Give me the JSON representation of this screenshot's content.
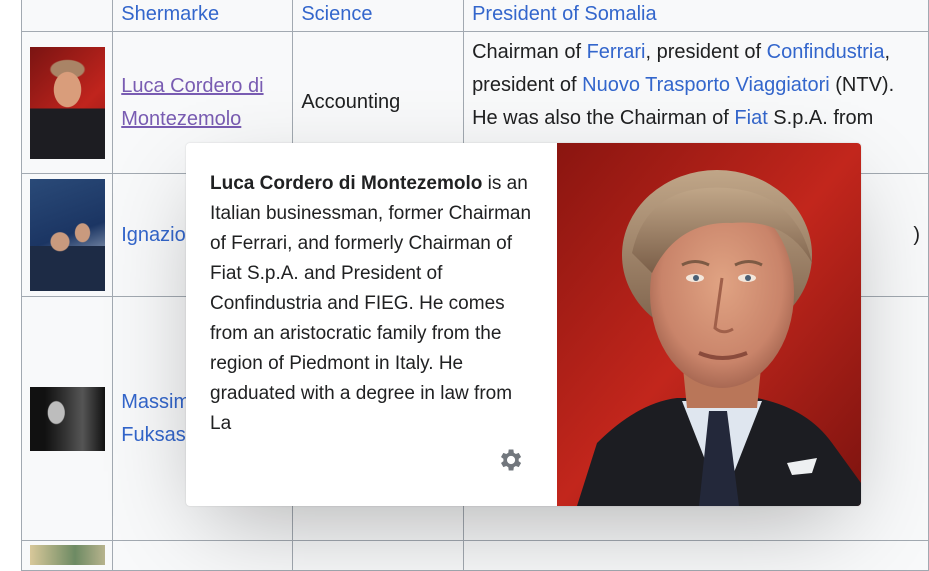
{
  "table": {
    "rows": [
      {
        "name": "Shermarke",
        "field": "Science",
        "note_parts": [
          {
            "text": "President of Somalia",
            "link": true
          }
        ]
      },
      {
        "thumb": "photo-montezemolo",
        "name": "Luca Cordero di Montezemolo",
        "visited": true,
        "field": "Accounting",
        "note_parts": [
          {
            "text": "Chairman of ",
            "link": false
          },
          {
            "text": "Ferrari",
            "link": true
          },
          {
            "text": ", president of ",
            "link": false
          },
          {
            "text": "Confindustria",
            "link": true
          },
          {
            "text": ", president of ",
            "link": false
          },
          {
            "text": "Nuovo Trasporto Viaggiatori",
            "link": true
          },
          {
            "text": " (NTV). He was also the Chairman of ",
            "link": false
          },
          {
            "text": "Fiat",
            "link": true
          },
          {
            "text": " S.p.A. from",
            "link": false
          }
        ]
      },
      {
        "thumb": "photo-ignazio",
        "name": "Ignazio",
        "field": "",
        "note_parts": [
          {
            "text": ")",
            "link": false
          }
        ]
      },
      {
        "thumb": "photo-massimiliano",
        "name": "Massimiliano Fuksas",
        "field": "",
        "note_parts": []
      },
      {
        "thumb": "photo-next",
        "name": "",
        "field": "",
        "note_parts": []
      }
    ]
  },
  "popup": {
    "title": "Luca Cordero di Montezemolo",
    "extract": " is an Italian businessman, former Chairman of Ferrari, and formerly Chairman of Fiat S.p.A. and President of Confindustria and FIEG. He comes from an aristocratic family from the region of Piedmont in Italy. He graduated with a degree in law from La",
    "settings_icon": "gear-icon",
    "image": "photo-montezemolo"
  },
  "colors": {
    "link": "#3366cc",
    "visited": "#795cb2",
    "table_bg": "#f8f9fa",
    "border": "#a2a9b1"
  }
}
